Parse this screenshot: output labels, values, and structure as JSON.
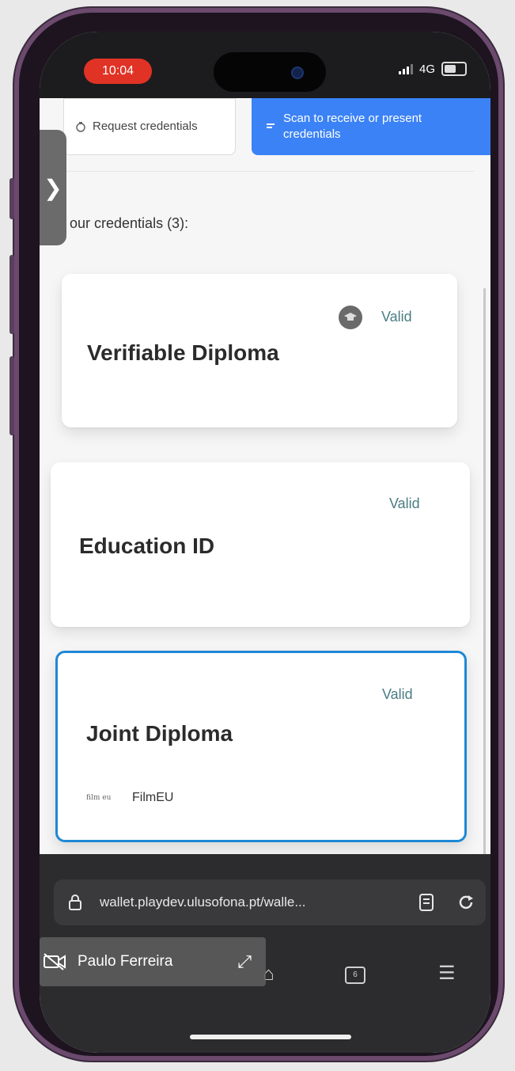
{
  "status_bar": {
    "time": "10:04",
    "network": "4G"
  },
  "actions": {
    "request_label": "Request credentials",
    "scan_label": "Scan to receive or present credentials"
  },
  "sidebar": {
    "toggle_glyph": "❯"
  },
  "credentials": {
    "heading": "our credentials (3):",
    "items": [
      {
        "title": "Verifiable Diploma",
        "status": "Valid",
        "icon": "graduation-cap-icon"
      },
      {
        "title": "Education ID",
        "status": "Valid"
      },
      {
        "title": "Joint Diploma",
        "status": "Valid",
        "issuer": "FilmEU",
        "issuer_logo_text": "film eu",
        "selected": true
      }
    ]
  },
  "browser": {
    "url": "wallet.playdev.ulusofona.pt/walle...",
    "tab_count": "6"
  },
  "video_overlay": {
    "participant_name": "Paulo Ferreira"
  },
  "colors": {
    "accent": "#3b82f6",
    "selected_border": "#1e88d6",
    "valid_text": "#4a7d84",
    "time_pill": "#e03325"
  }
}
